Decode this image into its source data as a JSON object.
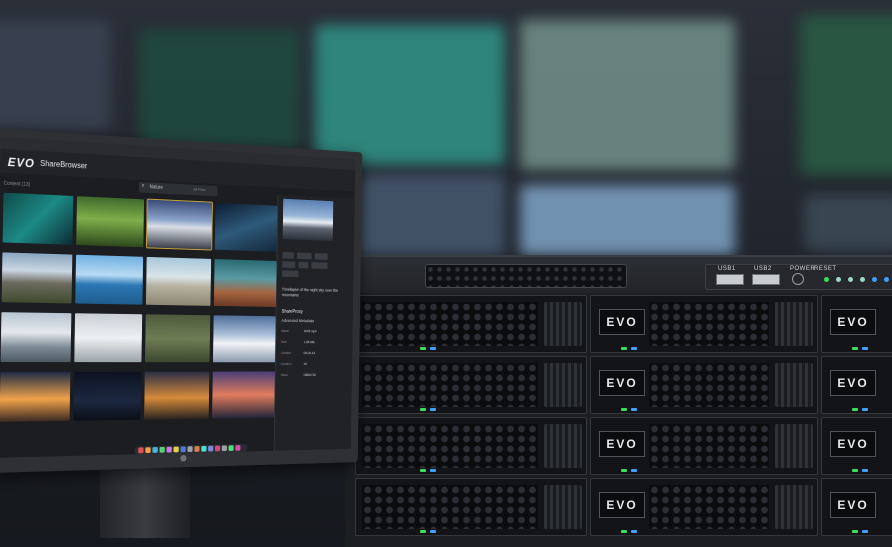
{
  "app": {
    "logo": "EVO",
    "title": "ShareBrowser",
    "content_label": "Content (13)",
    "search": {
      "placeholder": "Nature",
      "filter_label": "All Files"
    },
    "asset_description": "Timelapse of the night sky over the mountains",
    "proxy_label": "ShareProxy",
    "metadata_title": "Advanced Metadata",
    "metadata": [
      {
        "label": "Name",
        "value": "0025.mp4"
      },
      {
        "label": "Size",
        "value": "1.85 MB"
      },
      {
        "label": "Created",
        "value": "05-09-14"
      },
      {
        "label": "Duration",
        "value": "15"
      },
      {
        "label": "Video",
        "value": "1080x720"
      }
    ]
  },
  "server": {
    "bay_logo": "EVO",
    "front_panel": {
      "usb1": "USB1",
      "usb2": "USB2",
      "power": "POWER",
      "reset": "RESET"
    }
  },
  "colors": {
    "accent_selected": "#c9a43a",
    "led_green": "#3ddc5a",
    "led_blue": "#3fa0ff"
  }
}
